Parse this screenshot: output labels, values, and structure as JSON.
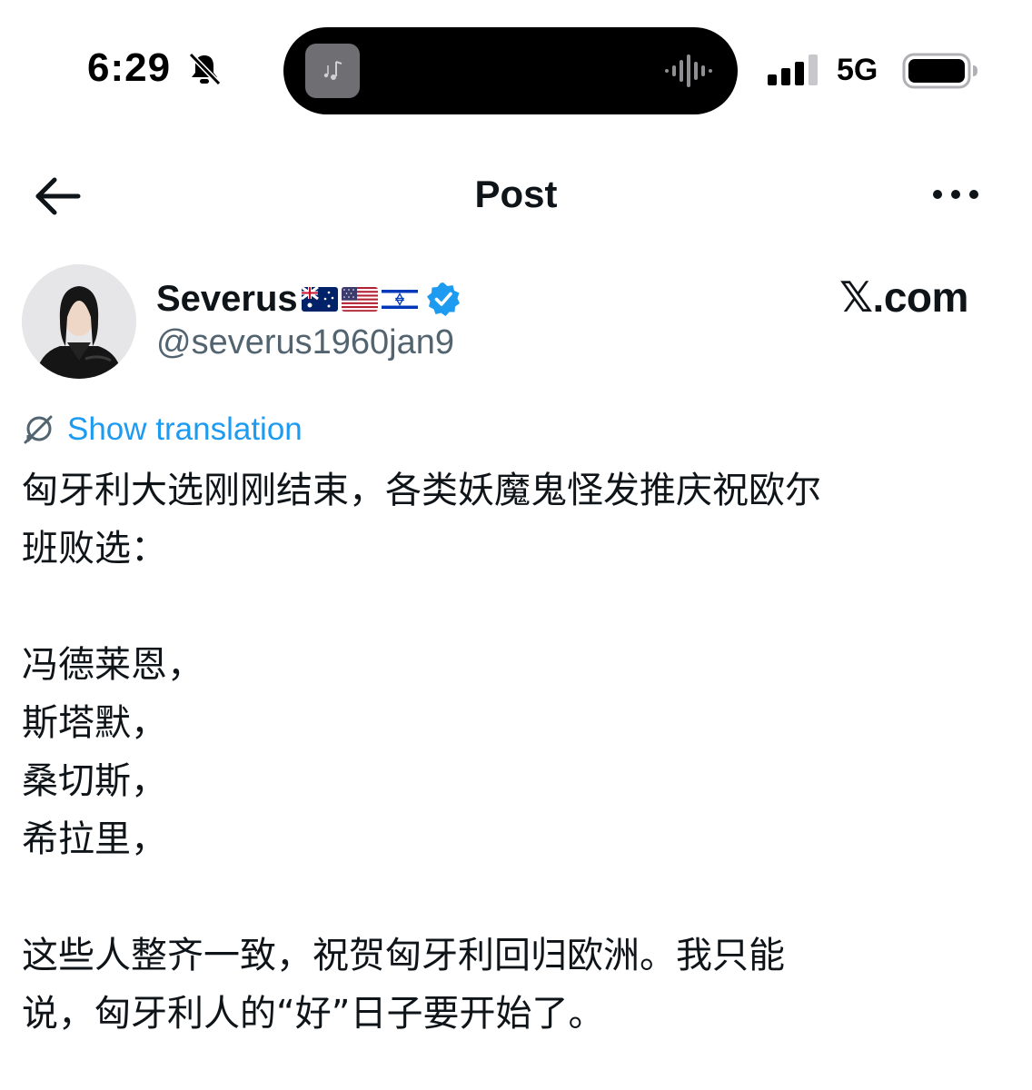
{
  "status_bar": {
    "time": "6:29",
    "network": "5G",
    "icons": [
      "bell-slash-icon",
      "signal-bars-icon",
      "battery-icon"
    ],
    "silent_mode": true,
    "signal_bars_filled": 3,
    "signal_bars_total": 4,
    "battery_level": 0.95
  },
  "header": {
    "title": "Post",
    "back_icon": "arrow-left-icon",
    "more_icon": "ellipsis-icon"
  },
  "author": {
    "display_name": "Severus",
    "flags": [
      "australia-flag",
      "usa-flag",
      "israel-flag"
    ],
    "verified": true,
    "handle": "@severus1960jan9"
  },
  "source_watermark": "𝕏.com",
  "translation": {
    "label": "Show translation"
  },
  "post": {
    "line1": "匈牙利大选刚刚结束，各类妖魔鬼怪发推庆祝欧尔",
    "line2": "班败选：",
    "name1": "冯德莱恩，",
    "name2": "斯塔默，",
    "name3": "桑切斯，",
    "name4": "希拉里，",
    "line3": "这些人整齐一致，祝贺匈牙利回归欧洲。我只能",
    "line4": "说，匈牙利人的“好”日子要开始了。"
  },
  "colors": {
    "text_primary": "#0f1419",
    "text_secondary": "#536471",
    "accent": "#1d9bf0",
    "background": "#ffffff"
  }
}
